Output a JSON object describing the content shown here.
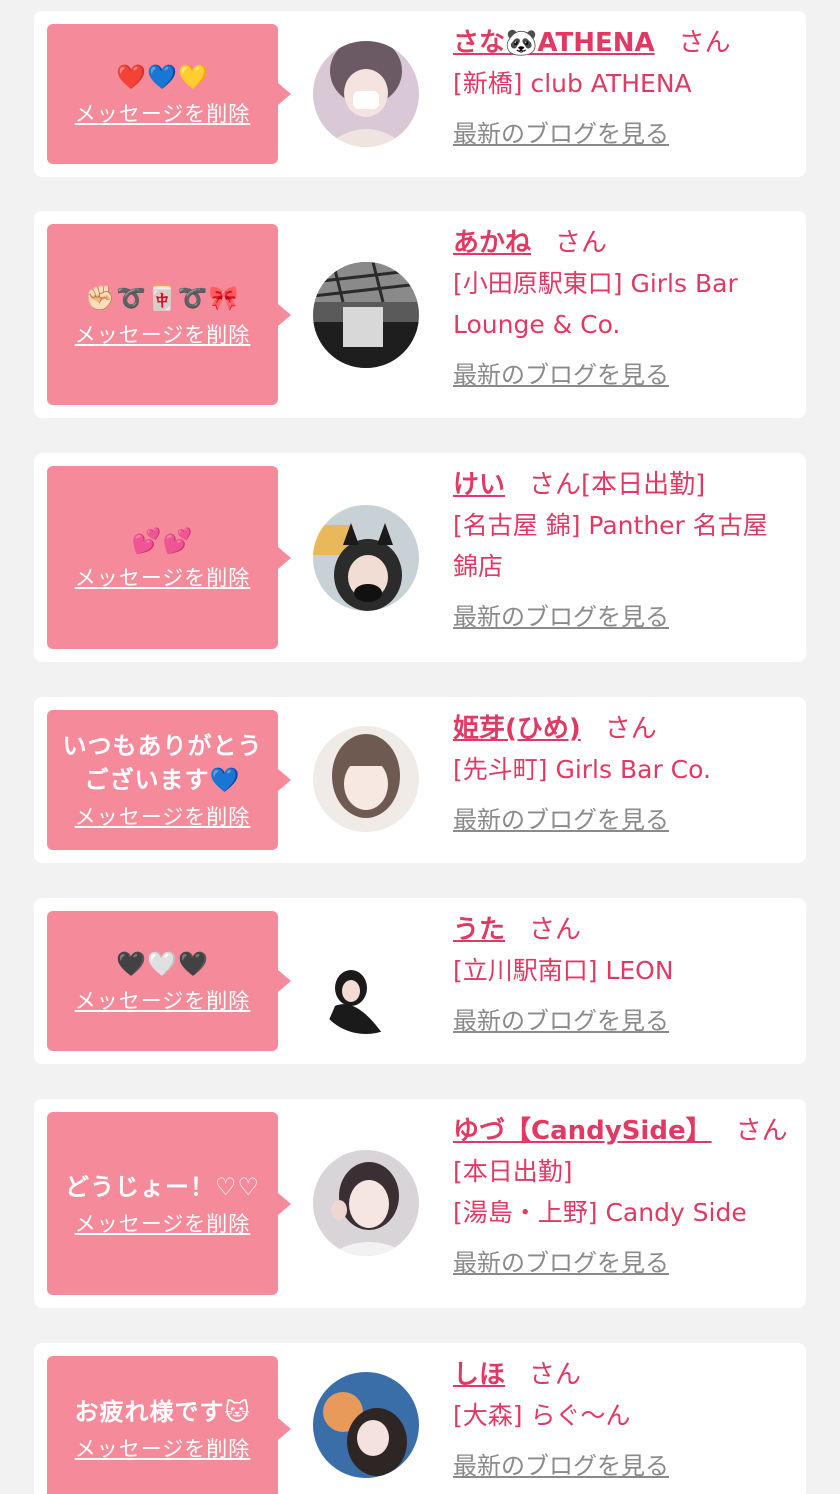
{
  "items": [
    {
      "message": "❤️💙💛",
      "delete_label": "メッセージを削除",
      "name": "さな🐼ATHENA",
      "honorific": "さん",
      "extra": "",
      "shop_lines": [
        "[新橋] club ATHENA"
      ],
      "blog_label": "最新のブログを見る",
      "avatar_colors": [
        "#d9c9d6",
        "#6b5a64"
      ]
    },
    {
      "message": "✊🏻➰🀄➰🎀",
      "delete_label": "メッセージを削除",
      "name": "あかね",
      "honorific": "さん",
      "extra": "",
      "shop_lines": [
        "[小田原駅東口] Girls Bar",
        "Lounge & Co."
      ],
      "blog_label": "最新のブログを見る",
      "avatar_colors": [
        "#8a8a8a",
        "#1e1e1e"
      ]
    },
    {
      "message": "💕💕",
      "delete_label": "メッセージを削除",
      "name": "けい",
      "honorific": "さん",
      "extra": "[本日出勤]",
      "shop_lines": [
        "[名古屋 錦] Panther 名古屋",
        "錦店"
      ],
      "blog_label": "最新のブログを見る",
      "avatar_colors": [
        "#c8d2d6",
        "#2b2b2b"
      ]
    },
    {
      "message": "いつもありがとう\nございます💙",
      "delete_label": "メッセージを削除",
      "name": "姫芽(ひめ)",
      "honorific": "さん",
      "extra": "",
      "shop_lines": [
        "[先斗町] Girls Bar Co."
      ],
      "blog_label": "最新のブログを見る",
      "avatar_colors": [
        "#f1ebe7",
        "#6e5a50"
      ]
    },
    {
      "message": "🖤🤍🖤",
      "delete_label": "メッセージを削除",
      "name": "うた",
      "honorific": "さん",
      "extra": "",
      "shop_lines": [
        "[立川駅南口] LEON"
      ],
      "blog_label": "最新のブログを見る",
      "avatar_colors": [
        "#ffffff",
        "#1a1a1a"
      ]
    },
    {
      "message": "どうじょー！♡♡",
      "delete_label": "メッセージを削除",
      "name": "ゆづ【CandySide】",
      "honorific": "さん",
      "extra": "",
      "shop_lines": [
        "[本日出勤]",
        "[湯島・上野] Candy Side"
      ],
      "blog_label": "最新のブログを見る",
      "avatar_colors": [
        "#d8d4d8",
        "#3a3034"
      ]
    },
    {
      "message": "お疲れ様です🐱",
      "delete_label": "メッセージを削除",
      "name": "しほ",
      "honorific": "さん",
      "extra": "",
      "shop_lines": [
        "[大森] らぐ〜ん"
      ],
      "blog_label": "最新のブログを見る",
      "avatar_colors": [
        "#3a6ea8",
        "#e89a5a"
      ]
    }
  ]
}
